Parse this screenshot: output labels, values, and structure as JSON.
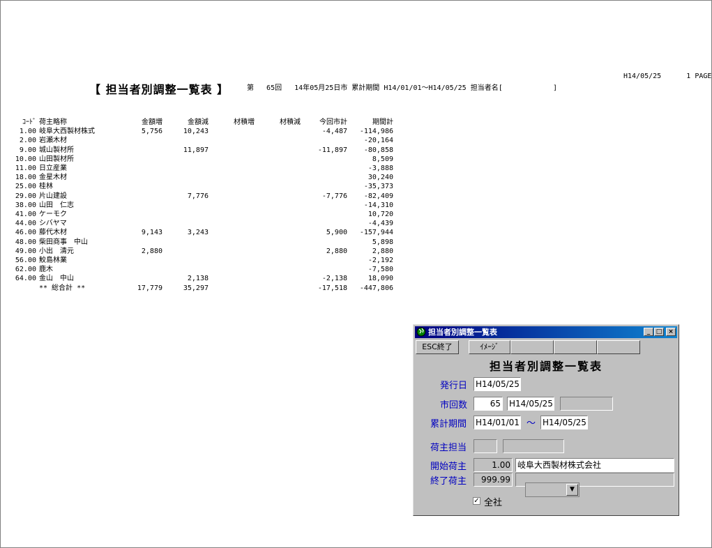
{
  "report": {
    "title": "【 担当者別調整一覧表 】",
    "header_info": "第   65回   14年05月25日市 累計期間 H14/01/01～H14/05/25 担当者名[            ]",
    "date_page": "H14/05/25      1 PAGE",
    "columns": [
      "ｺｰﾄﾞ",
      "荷主略称",
      "金額増",
      "金額減",
      "材積増",
      "材積減",
      "今回市計",
      "期間計"
    ],
    "rows": [
      [
        "1.00",
        "岐阜大西製材株式",
        "5,756",
        "10,243",
        "",
        "",
        "-4,487",
        "-114,986"
      ],
      [
        "2.00",
        "岩瀬木材",
        "",
        "",
        "",
        "",
        "",
        "-20,164"
      ],
      [
        "9.00",
        "城山製材所",
        "",
        "11,897",
        "",
        "",
        "-11,897",
        "-80,858"
      ],
      [
        "10.00",
        "山田製材所",
        "",
        "",
        "",
        "",
        "",
        "8,509"
      ],
      [
        "11.00",
        "日立産業",
        "",
        "",
        "",
        "",
        "",
        "-3,888"
      ],
      [
        "18.00",
        "金星木材",
        "",
        "",
        "",
        "",
        "",
        "30,240"
      ],
      [
        "25.00",
        "桂林",
        "",
        "",
        "",
        "",
        "",
        "-35,373"
      ],
      [
        "29.00",
        "片山建設",
        "",
        "7,776",
        "",
        "",
        "-7,776",
        "-82,409"
      ],
      [
        "38.00",
        "山田　仁志",
        "",
        "",
        "",
        "",
        "",
        "-14,310"
      ],
      [
        "41.00",
        "ケーモク",
        "",
        "",
        "",
        "",
        "",
        "10,720"
      ],
      [
        "44.00",
        "シバヤマ",
        "",
        "",
        "",
        "",
        "",
        "-4,439"
      ],
      [
        "46.00",
        "藤代木材",
        "9,143",
        "3,243",
        "",
        "",
        "5,900",
        "-157,944"
      ],
      [
        "48.00",
        "柴田商事　中山",
        "",
        "",
        "",
        "",
        "",
        "5,898"
      ],
      [
        "49.00",
        "小出　清元",
        "2,880",
        "",
        "",
        "",
        "2,880",
        "2,880"
      ],
      [
        "56.00",
        "鮫島林業",
        "",
        "",
        "",
        "",
        "",
        "-2,192"
      ],
      [
        "62.00",
        "鹿木",
        "",
        "",
        "",
        "",
        "",
        "-7,580"
      ],
      [
        "64.00",
        "金山　中山",
        "",
        "2,138",
        "",
        "",
        "-2,138",
        "18,090"
      ]
    ],
    "total": [
      "",
      "** 総合計 **",
      "17,779",
      "35,297",
      "",
      "",
      "-17,518",
      "-447,806"
    ]
  },
  "dialog": {
    "title": "担当者別調整一覧表",
    "min_glyph": "_",
    "max_glyph": "□",
    "close_glyph": "×",
    "esc_button": "ESC終了",
    "image_button": "ｲﾒｰｼﾞ",
    "form_title": "担当者別調整一覧表",
    "issue_date_label": "発行日",
    "issue_date": "H14/05/25",
    "market_count_label": "市回数",
    "market_count": "65",
    "market_date": "H14/05/25",
    "period_label": "累計期間",
    "period_from": "H14/01/01",
    "period_tilde": "～",
    "period_to": "H14/05/25",
    "shipper_staff_label": "荷主担当",
    "start_shipper_label": "開始荷主",
    "start_shipper_code": "1.00",
    "start_shipper_name": "岐阜大西製材株式会社",
    "end_shipper_label": "終了荷主",
    "end_shipper_code": "999.99",
    "combo_arrow": "▼",
    "all_company_check": "✓",
    "all_company_label": "全社"
  }
}
